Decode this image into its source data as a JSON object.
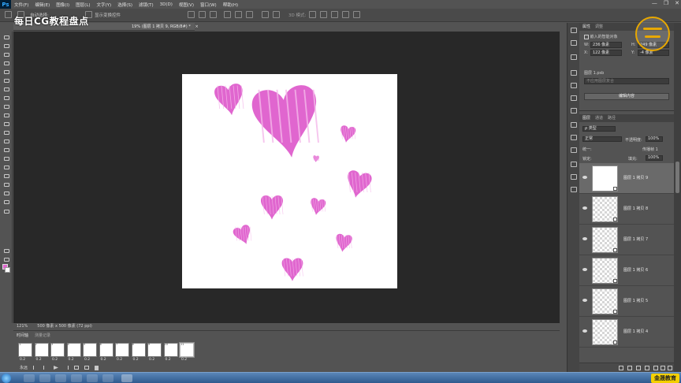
{
  "app": {
    "logo": "Ps"
  },
  "menu": [
    "文件(F)",
    "编辑(E)",
    "图像(I)",
    "图层(L)",
    "文字(Y)",
    "选择(S)",
    "滤镜(T)",
    "3D(D)",
    "视图(V)",
    "窗口(W)",
    "帮助(H)"
  ],
  "window_controls": {
    "minimize": "—",
    "restore": "❐",
    "close": "✕"
  },
  "options_bar": {
    "label_a": "自动选择:",
    "label_b": "显示变换控件",
    "mode_label": "3D 模式:"
  },
  "watermark": "每日CG教程盘点",
  "document_tab": {
    "title": "19% (图层 1 拷贝 9, RGB/8#) *",
    "close": "×"
  },
  "status": {
    "zoom": "121%",
    "doc_size": "500 像素 x 500 像素 (72 ppi)"
  },
  "timeline": {
    "tabs": [
      "时间轴",
      "测量记录"
    ],
    "frames": [
      {
        "num": "1",
        "delay": "0.2"
      },
      {
        "num": "2",
        "delay": "0.2"
      },
      {
        "num": "3",
        "delay": "0.2"
      },
      {
        "num": "4",
        "delay": "0.2"
      },
      {
        "num": "5",
        "delay": "0.2"
      },
      {
        "num": "6",
        "delay": "0.2"
      },
      {
        "num": "7",
        "delay": "0.2"
      },
      {
        "num": "8",
        "delay": "0.2"
      },
      {
        "num": "9",
        "delay": "0.2"
      },
      {
        "num": "10",
        "delay": "0.2"
      },
      {
        "num": "11",
        "delay": "0.2"
      }
    ],
    "loop": "永远"
  },
  "properties": {
    "tabs": [
      "属性",
      "调整"
    ],
    "type_label": "嵌入的智能对象",
    "w_label": "W:",
    "w_value": "236 像素",
    "h_label": "H:",
    "h_value": "249 像素",
    "x_label": "X:",
    "x_value": "122 像素",
    "y_label": "Y:",
    "y_value": "-4 像素",
    "file": "图层 1.psb",
    "comp_placeholder": "不应用图层复合",
    "edit_button": "编辑内容"
  },
  "layers": {
    "tabs": [
      "图层",
      "通道",
      "路径"
    ],
    "kind_label": "ρ 类型",
    "blend": "正常",
    "opacity_label": "不透明度:",
    "opacity": "100%",
    "unify_label": "统一:",
    "propagate_label": "传播帧 1",
    "lock_label": "锁定:",
    "fill_label": "填充:",
    "fill": "100%",
    "items": [
      {
        "name": "图层 1 拷贝 9",
        "selected": true
      },
      {
        "name": "图层 1 拷贝 8",
        "selected": false
      },
      {
        "name": "图层 1 拷贝 7",
        "selected": false
      },
      {
        "name": "图层 1 拷贝 6",
        "selected": false
      },
      {
        "name": "图层 1 拷贝 5",
        "selected": false
      },
      {
        "name": "图层 1 拷贝 4",
        "selected": false
      }
    ]
  },
  "branding": {
    "company": "金晟教育"
  },
  "colors": {
    "heart_pink": "#e066cf",
    "foreground": "#e066cf",
    "background": "#ffffff"
  }
}
